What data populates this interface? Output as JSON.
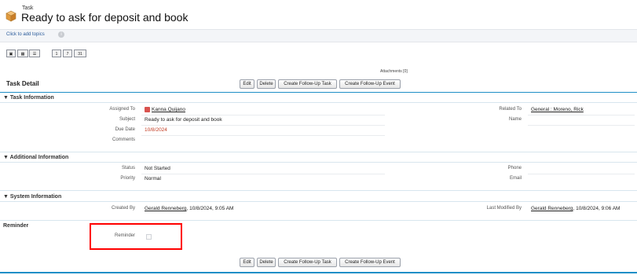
{
  "header": {
    "object_type": "Task",
    "title": "Ready to ask for deposit and book"
  },
  "topics": {
    "link": "Click to add topics",
    "info_icon": "info-icon"
  },
  "view_buttons": [
    {
      "label": "▣",
      "name": "view-person-icon"
    },
    {
      "label": "▦",
      "name": "view-grid-icon"
    },
    {
      "label": "☰",
      "name": "view-list-icon"
    },
    {
      "label": "1",
      "name": "view-day-button"
    },
    {
      "label": "7",
      "name": "view-week-button"
    },
    {
      "label": "31",
      "name": "view-month-button"
    }
  ],
  "attachments_link": "Attachments [0]",
  "detail": {
    "title": "Task Detail",
    "buttons": [
      "Edit",
      "Delete",
      "Create Follow-Up Task",
      "Create Follow-Up Event"
    ]
  },
  "task_information": {
    "heading": "Task Information",
    "assigned_to_label": "Assigned To",
    "assigned_to_value": "Kanna Quijano",
    "subject_label": "Subject",
    "subject_value": "Ready to ask for deposit and book",
    "due_date_label": "Due Date",
    "due_date_value": "10/8/2024",
    "comments_label": "Comments",
    "related_to_label": "Related To",
    "related_to_value": "General : Moreno, Rick",
    "name_label": "Name"
  },
  "additional_information": {
    "heading": "Additional Information",
    "status_label": "Status",
    "status_value": "Not Started",
    "priority_label": "Priority",
    "priority_value": "Normal",
    "phone_label": "Phone",
    "email_label": "Email"
  },
  "system_information": {
    "heading": "System Information",
    "created_by_label": "Created By",
    "created_by_name": "Gerald Renneberg",
    "created_by_date": ", 10/8/2024, 9:05 AM",
    "last_modified_label": "Last Modified By",
    "last_modified_name": "Gerald Renneberg",
    "last_modified_date": ", 10/8/2024, 9:06 AM"
  },
  "reminder": {
    "heading": "Reminder",
    "label": "Reminder",
    "checked": false
  },
  "colors": {
    "accent": "#1f8fc7",
    "highlight": "#ff0000",
    "due_date": "#c23b22"
  }
}
